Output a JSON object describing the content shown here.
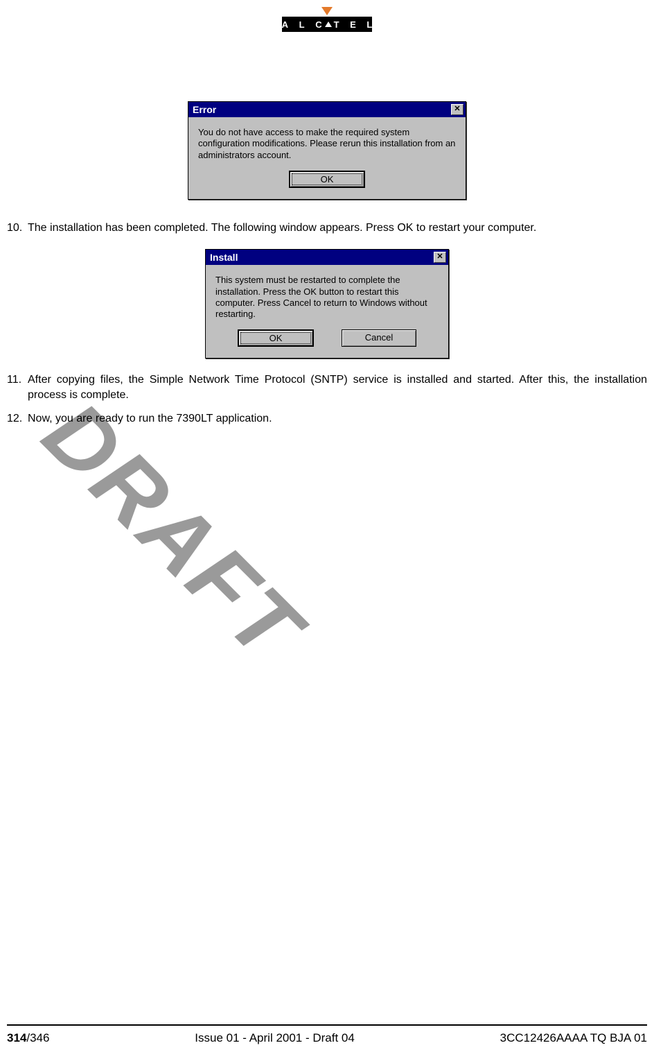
{
  "logo": {
    "text": "A L C A T E L"
  },
  "watermark": "DRAFT",
  "dialog_error": {
    "title": "Error",
    "message": "You do not have access to make the required system configuration modifications. Please rerun this installation from an administrators account.",
    "ok": "OK"
  },
  "steps": {
    "s10": {
      "num": "10.",
      "text": "The installation has been completed. The following window appears. Press OK to restart your computer."
    },
    "s11": {
      "num": "11.",
      "text": "After copying files, the Simple Network Time Protocol (SNTP) service is installed and started. After this, the installation process is complete."
    },
    "s12": {
      "num": "12.",
      "text": "Now, you are ready to run the 7390LT application."
    }
  },
  "dialog_install": {
    "title": "Install",
    "message": "This system must be restarted to complete the installation. Press the OK button to restart this computer. Press Cancel to return to Windows without restarting.",
    "ok": "OK",
    "cancel": "Cancel"
  },
  "footer": {
    "page_bold": "314",
    "page_total": "/346",
    "center": "Issue 01 - April 2001 - Draft 04",
    "right": "3CC12426AAAA TQ BJA 01"
  }
}
